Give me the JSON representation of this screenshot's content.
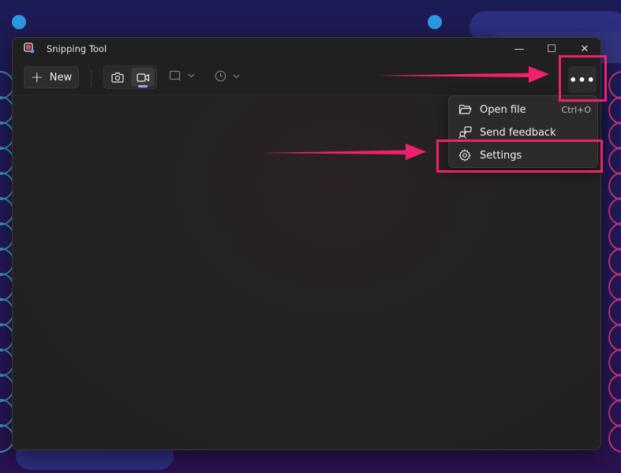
{
  "window": {
    "title": "Snipping Tool",
    "controls": {
      "minimize": "—",
      "maximize": "☐",
      "close": "✕"
    }
  },
  "toolbar": {
    "new_label": "New",
    "more_label": "•••"
  },
  "menu": {
    "items": [
      {
        "label": "Open file",
        "shortcut": "Ctrl+O",
        "icon": "folder-open-icon"
      },
      {
        "label": "Send feedback",
        "shortcut": "",
        "icon": "feedback-icon"
      },
      {
        "label": "Settings",
        "shortcut": "",
        "icon": "gear-icon"
      }
    ]
  },
  "colors": {
    "highlight": "#f0216a",
    "accent_indicator": "#a6a2f0",
    "desktop_dot": "#2b9be2"
  }
}
